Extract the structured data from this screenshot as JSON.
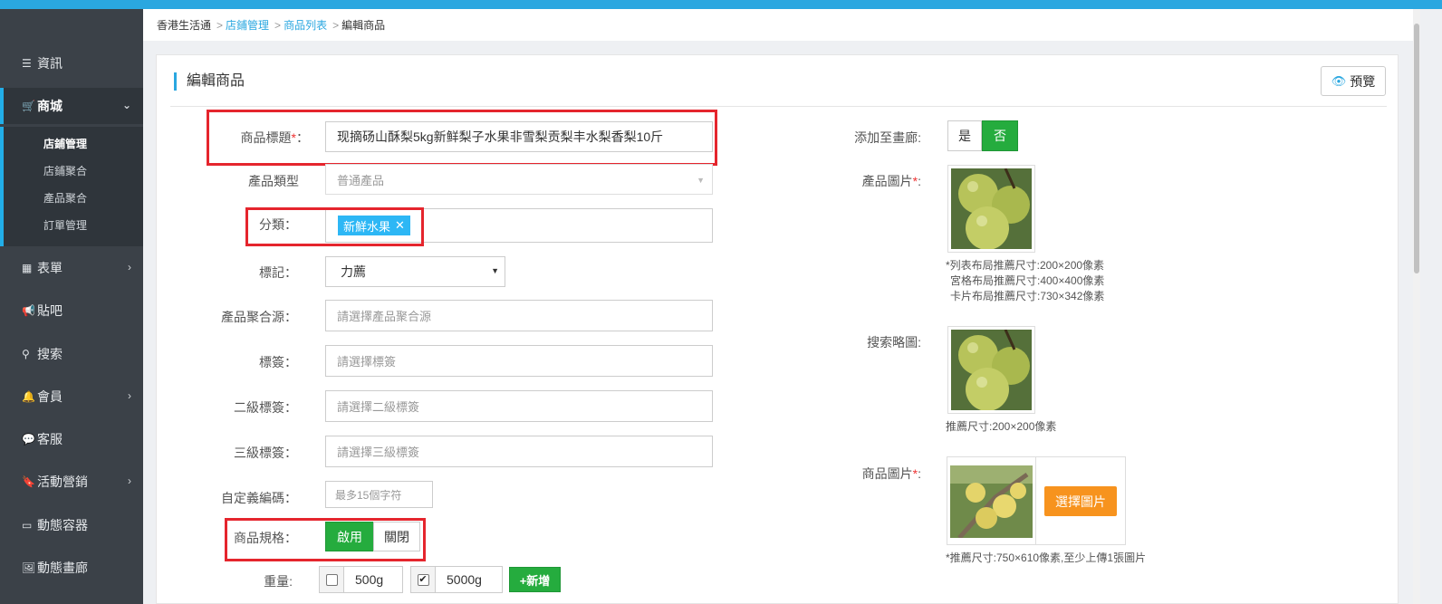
{
  "sidebar": {
    "items": [
      {
        "label": "資訊",
        "icon": "list-icon"
      },
      {
        "label": "商城",
        "icon": "cart-icon"
      },
      {
        "label": "表單",
        "icon": "table-icon"
      },
      {
        "label": "貼吧",
        "icon": "megaphone-icon"
      },
      {
        "label": "搜索",
        "icon": "search-icon"
      },
      {
        "label": "會員",
        "icon": "bell-icon"
      },
      {
        "label": "客服",
        "icon": "comment-icon"
      },
      {
        "label": "活動營銷",
        "icon": "bookmark-icon"
      },
      {
        "label": "動態容器",
        "icon": "hdd-icon"
      },
      {
        "label": "動態畫廊",
        "icon": "picture-icon"
      }
    ],
    "submenu": [
      {
        "label": "店鋪管理"
      },
      {
        "label": "店鋪聚合"
      },
      {
        "label": "產品聚合"
      },
      {
        "label": "訂單管理"
      }
    ]
  },
  "breadcrumb": {
    "home": "香港生活通",
    "level1": "店鋪管理",
    "level2": "商品列表",
    "current": "編輯商品"
  },
  "panel": {
    "title": "編輯商品",
    "preview_label": "預覽"
  },
  "form": {
    "title_label": "商品標題",
    "title_value": "现摘砀山酥梨5kg新鲜梨子水果非雪梨贡梨丰水梨香梨10斤",
    "product_type_label": "產品類型",
    "product_type_value": "普通產品",
    "category_label": "分類：",
    "category_tag": "新鮮水果",
    "mark_label": "標記：",
    "mark_value": "力薦",
    "aggregate_label": "產品聚合源：",
    "aggregate_placeholder": "請選擇產品聚合源",
    "tag_label": "標簽：",
    "tag_placeholder": "請選擇標簽",
    "tag2_label": "二級標簽：",
    "tag2_placeholder": "請選擇二級標簽",
    "tag3_label": "三級標簽：",
    "tag3_placeholder": "請選擇三級標簽",
    "code_label": "自定義編碼：",
    "code_placeholder": "最多15個字符",
    "spec_label": "商品規格：",
    "spec_on": "啟用",
    "spec_off": "關閉",
    "weight_label": "重量:",
    "weight_options": [
      "500g",
      "5000g"
    ],
    "add_button": "+新增"
  },
  "right": {
    "gallery_label": "添加至畫廊:",
    "gallery_yes": "是",
    "gallery_no": "否",
    "product_image_label": "產品圖片",
    "product_image_hint1": "*列表布局推薦尺寸:200×200像素",
    "product_image_hint2": "宮格布局推薦尺寸:400×400像素",
    "product_image_hint3": "卡片布局推薦尺寸:730×342像素",
    "thumb_label": "搜索略圖:",
    "thumb_hint": "推薦尺寸:200×200像素",
    "goods_image_label": "商品圖片",
    "select_image_button": "選擇圖片",
    "goods_image_hint": "*推薦尺寸:750×610像素,至少上傳1張圖片"
  },
  "colors": {
    "accent": "#2aa7e0",
    "sidebar_bg": "#3b4148",
    "green": "#25ac3e",
    "orange": "#f7931e",
    "highlight_red": "#e5252d"
  }
}
